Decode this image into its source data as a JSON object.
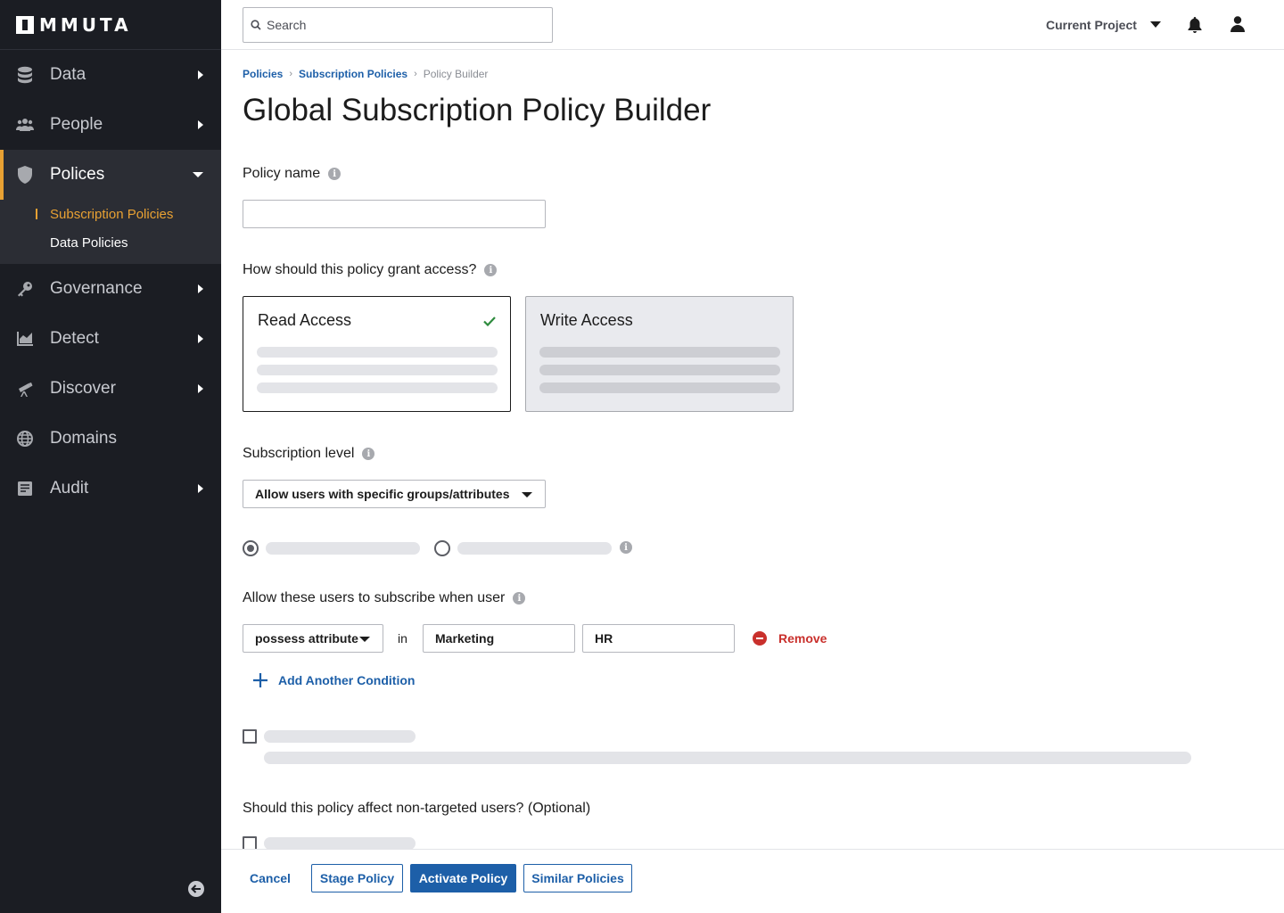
{
  "app": {
    "logo_text": "MMUTA"
  },
  "sidebar": {
    "items": [
      {
        "label": "Data",
        "icon": "database-icon"
      },
      {
        "label": "People",
        "icon": "people-icon"
      },
      {
        "label": "Polices",
        "icon": "shield-icon"
      },
      {
        "label": "Governance",
        "icon": "key-icon"
      },
      {
        "label": "Detect",
        "icon": "chart-icon"
      },
      {
        "label": "Discover",
        "icon": "telescope-icon"
      },
      {
        "label": "Domains",
        "icon": "globe-icon"
      },
      {
        "label": "Audit",
        "icon": "audit-icon"
      }
    ],
    "subitems": [
      {
        "label": "Subscription Policies",
        "active": true
      },
      {
        "label": "Data Policies",
        "active": false
      }
    ],
    "accent_color": "#e8a133"
  },
  "header": {
    "search_placeholder": "Search",
    "project_label": "Current Project"
  },
  "breadcrumb": [
    "Policies",
    "Subscription Policies",
    "Policy Builder"
  ],
  "page": {
    "title": "Global Subscription Policy Builder",
    "policy_name_label": "Policy name",
    "policy_name_value": "",
    "access_label": "How should this policy grant access?",
    "access_options": [
      {
        "label": "Read Access",
        "selected": true
      },
      {
        "label": "Write Access",
        "selected": false
      }
    ],
    "subscription_level_label": "Subscription level",
    "subscription_level_value": "Allow users with specific groups/attributes",
    "allow_label": "Allow these users to subscribe when user",
    "condition": {
      "operator": "possess attribute",
      "in_text": "in",
      "attribute_key": "Marketing",
      "attribute_value": "HR",
      "remove_label": "Remove"
    },
    "add_condition_label": "Add Another Condition",
    "non_targeted_label": "Should this policy affect non-targeted users? (Optional)"
  },
  "footer": {
    "cancel": "Cancel",
    "stage": "Stage Policy",
    "activate": "Activate Policy",
    "similar": "Similar Policies"
  },
  "colors": {
    "primary": "#1d5fa8",
    "danger": "#c9302c",
    "success": "#2e8b3e",
    "sidebar_bg": "#1b1d23"
  }
}
